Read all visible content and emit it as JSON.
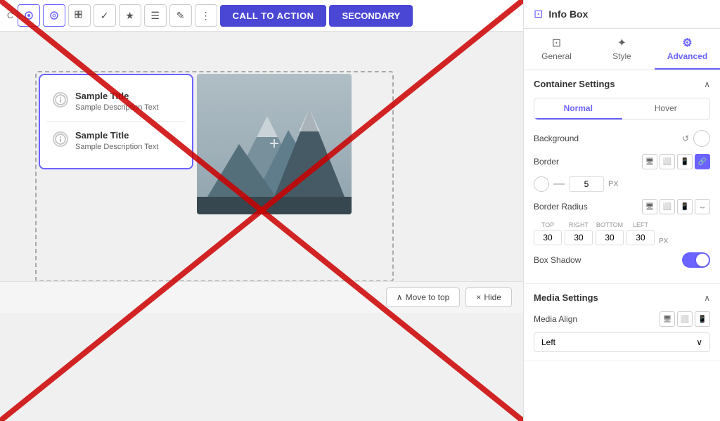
{
  "panel": {
    "title": "Info Box",
    "tabs": [
      {
        "id": "general",
        "label": "General",
        "icon": "⊡",
        "active": false
      },
      {
        "id": "style",
        "label": "Style",
        "icon": "✦",
        "active": false
      },
      {
        "id": "advanced",
        "label": "Advanced",
        "icon": "⚙",
        "active": true
      }
    ],
    "container_settings": {
      "title": "Container Settings",
      "state_tabs": [
        "Normal",
        "Hover"
      ],
      "active_state": "Normal",
      "background_label": "Background",
      "border_label": "Border",
      "border_value": "5",
      "border_unit": "PX",
      "border_radius_label": "Border Radius",
      "border_radius": {
        "top": "30",
        "right": "30",
        "bottom": "30",
        "left": "30",
        "unit": "PX"
      },
      "box_shadow_label": "Box Shadow",
      "box_shadow_enabled": true
    },
    "media_settings": {
      "title": "Media Settings",
      "media_align_label": "Media Align",
      "media_align_value": "Left"
    }
  },
  "toolbar": {
    "label": "C",
    "cta_label": "CALL TO ACTION",
    "secondary_label": "SECONDARY"
  },
  "canvas": {
    "items": [
      {
        "title": "Sample Title",
        "description": "Sample Description Text"
      },
      {
        "title": "Sample Title",
        "description": "Sample Description Text"
      }
    ]
  },
  "bottom_bar": {
    "move_to_top": "Move to top",
    "hide": "Hide"
  }
}
